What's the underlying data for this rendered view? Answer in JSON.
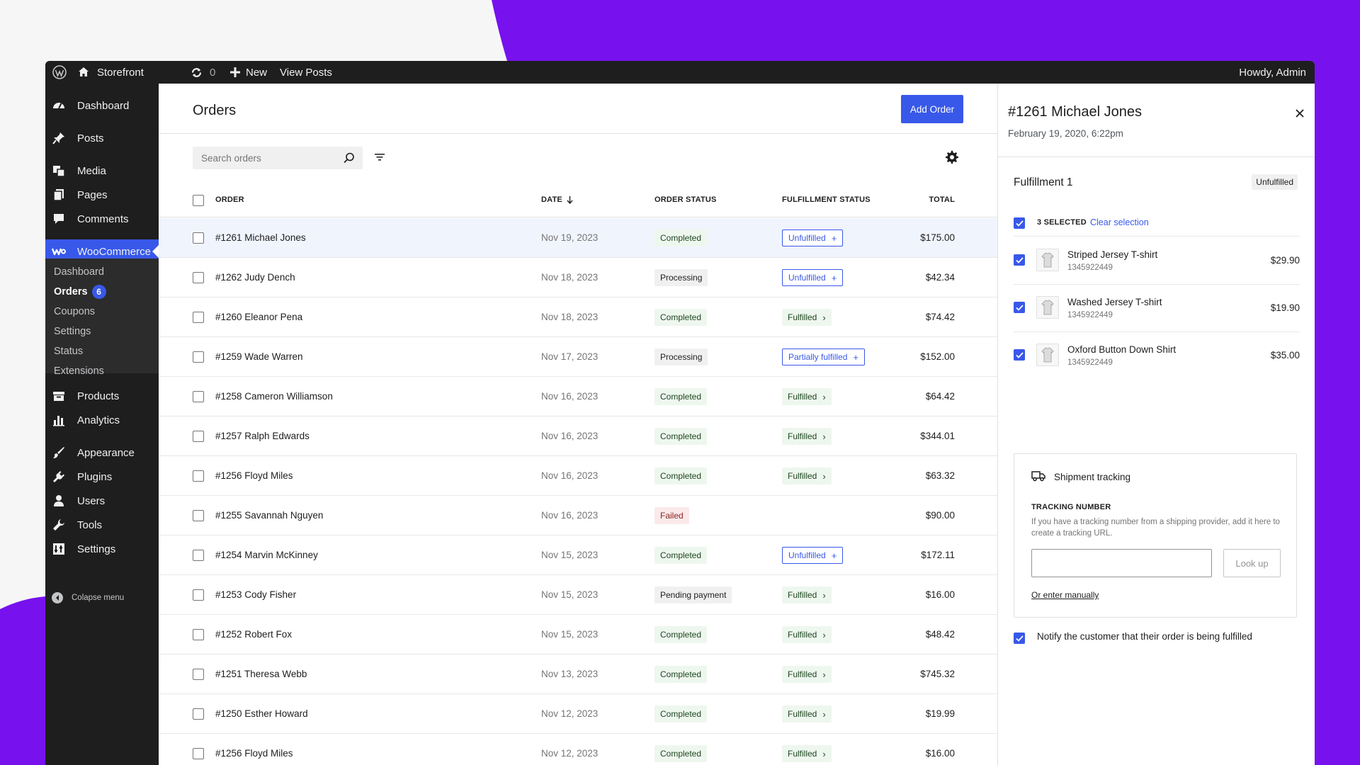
{
  "colors": {
    "accent": "#3858e9",
    "backdrop": "#7711ee",
    "adminbar": "#1e1e1e"
  },
  "adminbar": {
    "site_name": "Storefront",
    "updates_count": "0",
    "new_label": "New",
    "view_posts_label": "View Posts",
    "howdy_label": "Howdy, Admin"
  },
  "sidebar": {
    "items": [
      {
        "label": "Dashboard",
        "icon": "dashboard-icon"
      },
      {
        "label": "Posts",
        "icon": "pin-icon"
      },
      {
        "label": "Media",
        "icon": "media-icon"
      },
      {
        "label": "Pages",
        "icon": "pages-icon"
      },
      {
        "label": "Comments",
        "icon": "comments-icon"
      },
      {
        "label": "WooCommerce",
        "icon": "woo-icon"
      },
      {
        "label": "Products",
        "icon": "products-icon"
      },
      {
        "label": "Analytics",
        "icon": "analytics-icon"
      },
      {
        "label": "Appearance",
        "icon": "brush-icon"
      },
      {
        "label": "Plugins",
        "icon": "plugin-icon"
      },
      {
        "label": "Users",
        "icon": "user-icon"
      },
      {
        "label": "Tools",
        "icon": "wrench-icon"
      },
      {
        "label": "Settings",
        "icon": "settings-icon"
      }
    ],
    "submenu": [
      {
        "label": "Dashboard"
      },
      {
        "label": "Orders",
        "badge": "6"
      },
      {
        "label": "Coupons"
      },
      {
        "label": "Settings"
      },
      {
        "label": "Status"
      },
      {
        "label": "Extensions"
      }
    ],
    "collapse_label": "Colapse menu"
  },
  "main": {
    "title": "Orders",
    "add_order_label": "Add Order",
    "search_placeholder": "Search orders",
    "columns": {
      "order": "ORDER",
      "date": "DATE",
      "order_status": "ORDER STATUS",
      "fulfillment_status": "FULFILLMENT STATUS",
      "total": "TOTAL"
    },
    "rows": [
      {
        "order": "#1261 Michael Jones",
        "date": "Nov 19, 2023",
        "status": "Completed",
        "status_kind": "completed",
        "fulfillment": "Unfulfilled",
        "ful_kind": "outline",
        "total": "$175.00",
        "selected": true
      },
      {
        "order": "#1262 Judy Dench",
        "date": "Nov 18, 2023",
        "status": "Processing",
        "status_kind": "processing",
        "fulfillment": "Unfulfilled",
        "ful_kind": "outline",
        "total": "$42.34"
      },
      {
        "order": "#1260 Eleanor Pena",
        "date": "Nov 18, 2023",
        "status": "Completed",
        "status_kind": "completed",
        "fulfillment": "Fulfilled",
        "ful_kind": "fulfilled",
        "total": "$74.42"
      },
      {
        "order": "#1259 Wade Warren",
        "date": "Nov 17, 2023",
        "status": "Processing",
        "status_kind": "processing",
        "fulfillment": "Partially fulfilled",
        "ful_kind": "outline",
        "total": "$152.00"
      },
      {
        "order": "#1258 Cameron Williamson",
        "date": "Nov 16, 2023",
        "status": "Completed",
        "status_kind": "completed",
        "fulfillment": "Fulfilled",
        "ful_kind": "fulfilled",
        "total": "$64.42"
      },
      {
        "order": "#1257 Ralph Edwards",
        "date": "Nov 16, 2023",
        "status": "Completed",
        "status_kind": "completed",
        "fulfillment": "Fulfilled",
        "ful_kind": "fulfilled",
        "total": "$344.01"
      },
      {
        "order": "#1256 Floyd Miles",
        "date": "Nov 16, 2023",
        "status": "Completed",
        "status_kind": "completed",
        "fulfillment": "Fulfilled",
        "ful_kind": "fulfilled",
        "total": "$63.32"
      },
      {
        "order": "#1255 Savannah Nguyen",
        "date": "Nov 16, 2023",
        "status": "Failed",
        "status_kind": "failed",
        "fulfillment": "",
        "ful_kind": "none",
        "total": "$90.00"
      },
      {
        "order": "#1254 Marvin McKinney",
        "date": "Nov 15, 2023",
        "status": "Completed",
        "status_kind": "completed",
        "fulfillment": "Unfulfilled",
        "ful_kind": "outline",
        "total": "$172.11"
      },
      {
        "order": "#1253 Cody Fisher",
        "date": "Nov 15, 2023",
        "status": "Pending payment",
        "status_kind": "pending",
        "fulfillment": "Fulfilled",
        "ful_kind": "fulfilled",
        "total": "$16.00"
      },
      {
        "order": "#1252 Robert Fox",
        "date": "Nov 15, 2023",
        "status": "Completed",
        "status_kind": "completed",
        "fulfillment": "Fulfilled",
        "ful_kind": "fulfilled",
        "total": "$48.42"
      },
      {
        "order": "#1251 Theresa Webb",
        "date": "Nov 13, 2023",
        "status": "Completed",
        "status_kind": "completed",
        "fulfillment": "Fulfilled",
        "ful_kind": "fulfilled",
        "total": "$745.32"
      },
      {
        "order": "#1250 Esther Howard",
        "date": "Nov 12, 2023",
        "status": "Completed",
        "status_kind": "completed",
        "fulfillment": "Fulfilled",
        "ful_kind": "fulfilled",
        "total": "$19.99"
      },
      {
        "order": "#1256 Floyd Miles",
        "date": "Nov 12, 2023",
        "status": "Completed",
        "status_kind": "completed",
        "fulfillment": "Fulfilled",
        "ful_kind": "fulfilled",
        "total": "$16.00"
      }
    ]
  },
  "panel": {
    "title": "#1261 Michael Jones",
    "date": "February 19, 2020, 6:22pm",
    "fulfillment_title": "Fulfillment 1",
    "fulfillment_badge": "Unfulfilled",
    "selected_count": "3 SELECTED",
    "clear_selection": "Clear selection",
    "items": [
      {
        "name": "Striped Jersey T-shirt",
        "sku": "1345922449",
        "price": "$29.90"
      },
      {
        "name": "Washed Jersey T-shirt",
        "sku": "1345922449",
        "price": "$19.90"
      },
      {
        "name": "Oxford Button Down Shirt",
        "sku": "1345922449",
        "price": "$35.00"
      }
    ],
    "tracking": {
      "title": "Shipment tracking",
      "label": "TRACKING NUMBER",
      "help": "If you have a tracking number from a shipping provider, add it here to create a tracking URL.",
      "input_value": "",
      "lookup_label": "Look up",
      "manual_link": "Or enter manually"
    },
    "notify_label": "Notify the customer that their order is being fulfilled"
  }
}
